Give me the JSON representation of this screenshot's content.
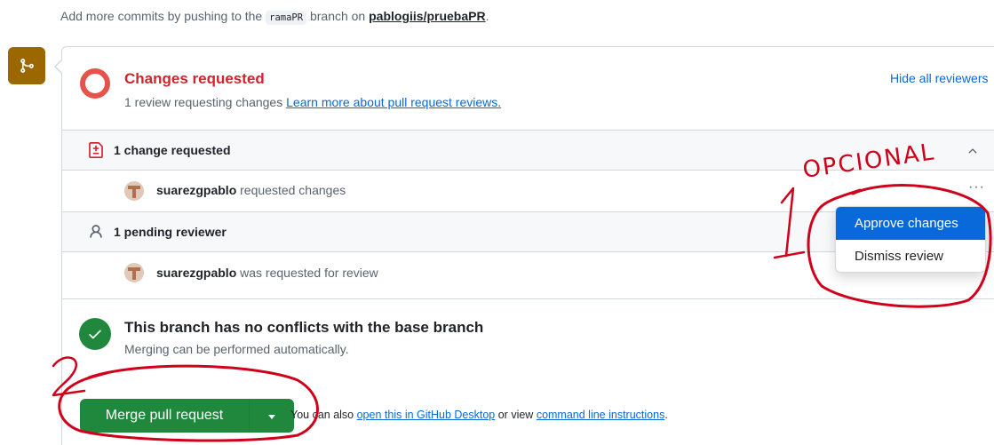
{
  "top_note": {
    "prefix": "Add more commits by pushing to the",
    "branch": "ramaPR",
    "middle": "branch on",
    "repo": "pablogiis/pruebaPR",
    "suffix": "."
  },
  "status": {
    "title": "Changes requested",
    "subtitle": "1 review requesting changes",
    "learn_link": "Learn more about pull request reviews.",
    "hide_reviewers": "Hide all reviewers"
  },
  "changes_section": {
    "header": "1 change requested",
    "reviewer": {
      "name": "suarezgpablo",
      "action": "requested changes"
    },
    "more_menu_icon": "kebab-horizontal-icon"
  },
  "pending_section": {
    "header": "1 pending reviewer",
    "reviewer": {
      "name": "suarezgpablo",
      "action": "was requested for review"
    }
  },
  "dropdown": {
    "items": [
      "Approve changes",
      "Dismiss review"
    ]
  },
  "conflicts": {
    "title": "This branch has no conflicts with the base branch",
    "subtitle": "Merging can be performed automatically."
  },
  "merge": {
    "button_label": "Merge pull request",
    "also_prefix": "You can also",
    "desktop_link": "open this in GitHub Desktop",
    "or_view": "or view",
    "cli_link": "command line instructions",
    "suffix": "."
  },
  "annotations": {
    "optional_label": "OPCIONAL",
    "step_one": "1",
    "step_two": "2",
    "color": "#d0021b"
  },
  "colors": {
    "danger": "#d1242f",
    "success": "#1f883d",
    "link": "#0969da",
    "merge_badge": "#9a6700"
  }
}
